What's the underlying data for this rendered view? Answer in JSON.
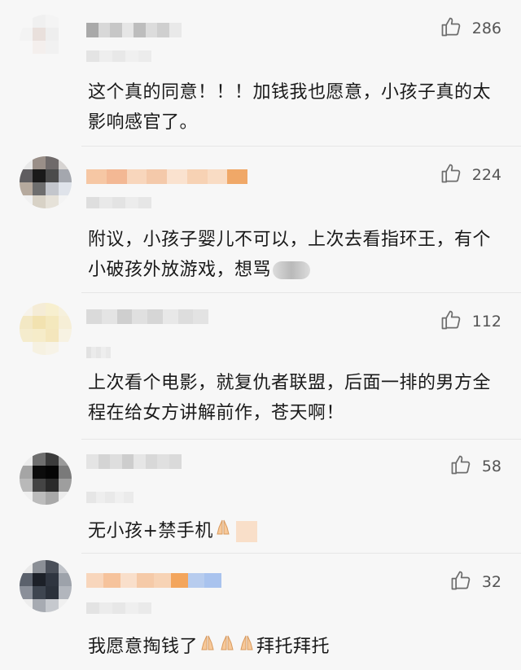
{
  "comments": [
    {
      "likes": "286",
      "text": "这个真的同意！！！加钱我也愿意，小孩子真的太影响感官了。",
      "avatar_colors": [
        "#f7f7f7",
        "#f0f0f0",
        "#f4f4f4",
        "#f7f7f7",
        "#f3f3f3",
        "#e9e0dc",
        "#eee",
        "#f7f7f7",
        "#f7f7f7",
        "#f4efed",
        "#f1f1f1",
        "#f7f7f7",
        "#f7f7f7",
        "#f7f7f7",
        "#f7f7f7",
        "#f7f7f7"
      ],
      "name_colors": [
        "#a9a9a9",
        "#d8d8d8",
        "#c7c7c7",
        "#e6e6e6",
        "#bdbdbd",
        "#dcdcdc",
        "#cfcfcf",
        "#e9e9e9"
      ],
      "sub_colors": [
        "#e4e4e4",
        "#eeeeee",
        "#e8e8e8",
        "#f0f0f0",
        "#ececec"
      ]
    },
    {
      "likes": "224",
      "text": "附议，小孩子婴儿不可以，上次去看指环王，有个小破孩外放游戏，想骂",
      "avatar_colors": [
        "#e9e9e9",
        "#9a8f88",
        "#6f6a6a",
        "#d7d4d2",
        "#5f5d60",
        "#1a1a1a",
        "#4b4b4b",
        "#a4a7ae",
        "#b6aa9e",
        "#6e6e6e",
        "#c3c6cc",
        "#dfe3ea",
        "#f1f1f1",
        "#d8d2c6",
        "#e6e2d9",
        "#f4f4f4"
      ],
      "name_colors": [
        "#f6c7a4",
        "#f3b894",
        "#f8d6bc",
        "#f4c9aa",
        "#fae2cf",
        "#f7d2b4",
        "#f9dcc4",
        "#f0a868"
      ],
      "sub_colors": [
        "#dedede",
        "#e9e9e9",
        "#e3e3e3",
        "#ececec",
        "#e6e6e6"
      ]
    },
    {
      "likes": "112",
      "text": "上次看个电影，就复仇者联盟，后面一排的男方全程在给女方讲解前作，苍天啊！",
      "avatar_colors": [
        "#f7f3ea",
        "#f5ecd6",
        "#f7efcf",
        "#f6f0dc",
        "#f3e8c4",
        "#f2e2b0",
        "#f4e8bd",
        "#f6eed6",
        "#f5eccd",
        "#f6ecc9",
        "#f4e6bc",
        "#f7f2e2",
        "#f7f7f7",
        "#f6f1e1",
        "#f7f3e7",
        "#f7f7f7"
      ],
      "name_colors": [
        "#dadada",
        "#e4e4e4",
        "#cfcfcf",
        "#e0e0e0",
        "#d6d6d6",
        "#e8e8e8",
        "#dddddd",
        "#e3e3e3"
      ],
      "sub_colors": [
        "#e2e2e2",
        "#ebebeb",
        "#e6e6e6",
        "#eeeeee",
        "#e9e9e9"
      ]
    },
    {
      "likes": "58",
      "text": "无小孩+禁手机",
      "avatar_colors": [
        "#ececec",
        "#6f6f6f",
        "#3b3b3b",
        "#9a9a9a",
        "#a5a5a5",
        "#0c0c0c",
        "#050505",
        "#7a7a7a",
        "#b9b9b9",
        "#444444",
        "#2a2a2a",
        "#9e9e9e",
        "#f0f0f0",
        "#bcbcbc",
        "#a8a8a8",
        "#ececec"
      ],
      "name_colors": [
        "#e4e4e4",
        "#d4d4d4",
        "#dedede",
        "#cdcdcd",
        "#e6e6e6",
        "#d8d8d8",
        "#e0e0e0",
        "#dadada"
      ],
      "sub_colors": [
        "#e6e6e6",
        "#eeeeee",
        "#e9e9e9",
        "#f0f0f0",
        "#ebebeb"
      ]
    },
    {
      "likes": "32",
      "text": "我愿意掏钱了",
      "text_tail": "拜托拜托",
      "avatar_colors": [
        "#e9e9e9",
        "#8b8f96",
        "#4a4f59",
        "#bfc2c8",
        "#5b616c",
        "#1c2028",
        "#2f3540",
        "#9da2aa",
        "#8a8f99",
        "#3e4550",
        "#2b313b",
        "#b2b6bd",
        "#ededed",
        "#a7abb2",
        "#c6c9ce",
        "#f0f0f0"
      ],
      "name_colors": [
        "#f8d6bc",
        "#f6c39c",
        "#f9dfcb",
        "#f5caa8",
        "#f7d3b5",
        "#f3a55c",
        "#b7ccee",
        "#a9c3ee"
      ],
      "sub_colors": [
        "#e3e3e3",
        "#ececec",
        "#e7e7e7",
        "#efefef",
        "#eaeaea"
      ]
    }
  ],
  "colors": {
    "background": "#f7f7f7",
    "text": "#1a1a1a",
    "like_count": "#555555",
    "like_icon": "#6d6d6d"
  },
  "icons": {
    "like": "thumbs-up-outline-icon",
    "pray": "folded-hands-emoji-icon"
  }
}
